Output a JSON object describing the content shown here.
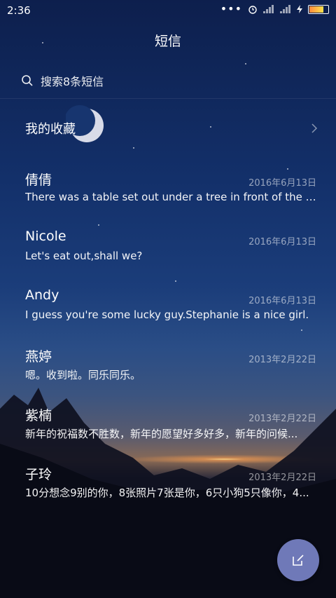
{
  "status_bar": {
    "time": "2:36"
  },
  "header": {
    "title": "短信"
  },
  "search": {
    "placeholder": "搜索8条短信"
  },
  "favorites": {
    "label": "我的收藏"
  },
  "conversations": [
    {
      "name": "倩倩",
      "date": "2016年6月13日",
      "preview": "There was a table set out under a tree in front of the ho..."
    },
    {
      "name": "Nicole",
      "date": "2016年6月13日",
      "preview": "Let's eat out,shall we?"
    },
    {
      "name": "Andy",
      "date": "2016年6月13日",
      "preview": "I guess you're some lucky guy.Stephanie is a nice girl."
    },
    {
      "name": "燕婷",
      "date": "2013年2月22日",
      "preview": "嗯。收到啦。同乐同乐。"
    },
    {
      "name": "紫楠",
      "date": "2013年2月22日",
      "preview": "新年的祝福数不胜数，新年的愿望好多好多，新年的问候..."
    },
    {
      "name": "子玲",
      "date": "2013年2月22日",
      "preview": "10分想念9别的你，8张照片7张是你，6只小狗5只像你，4..."
    }
  ],
  "fab": {
    "icon": "compose-icon"
  }
}
